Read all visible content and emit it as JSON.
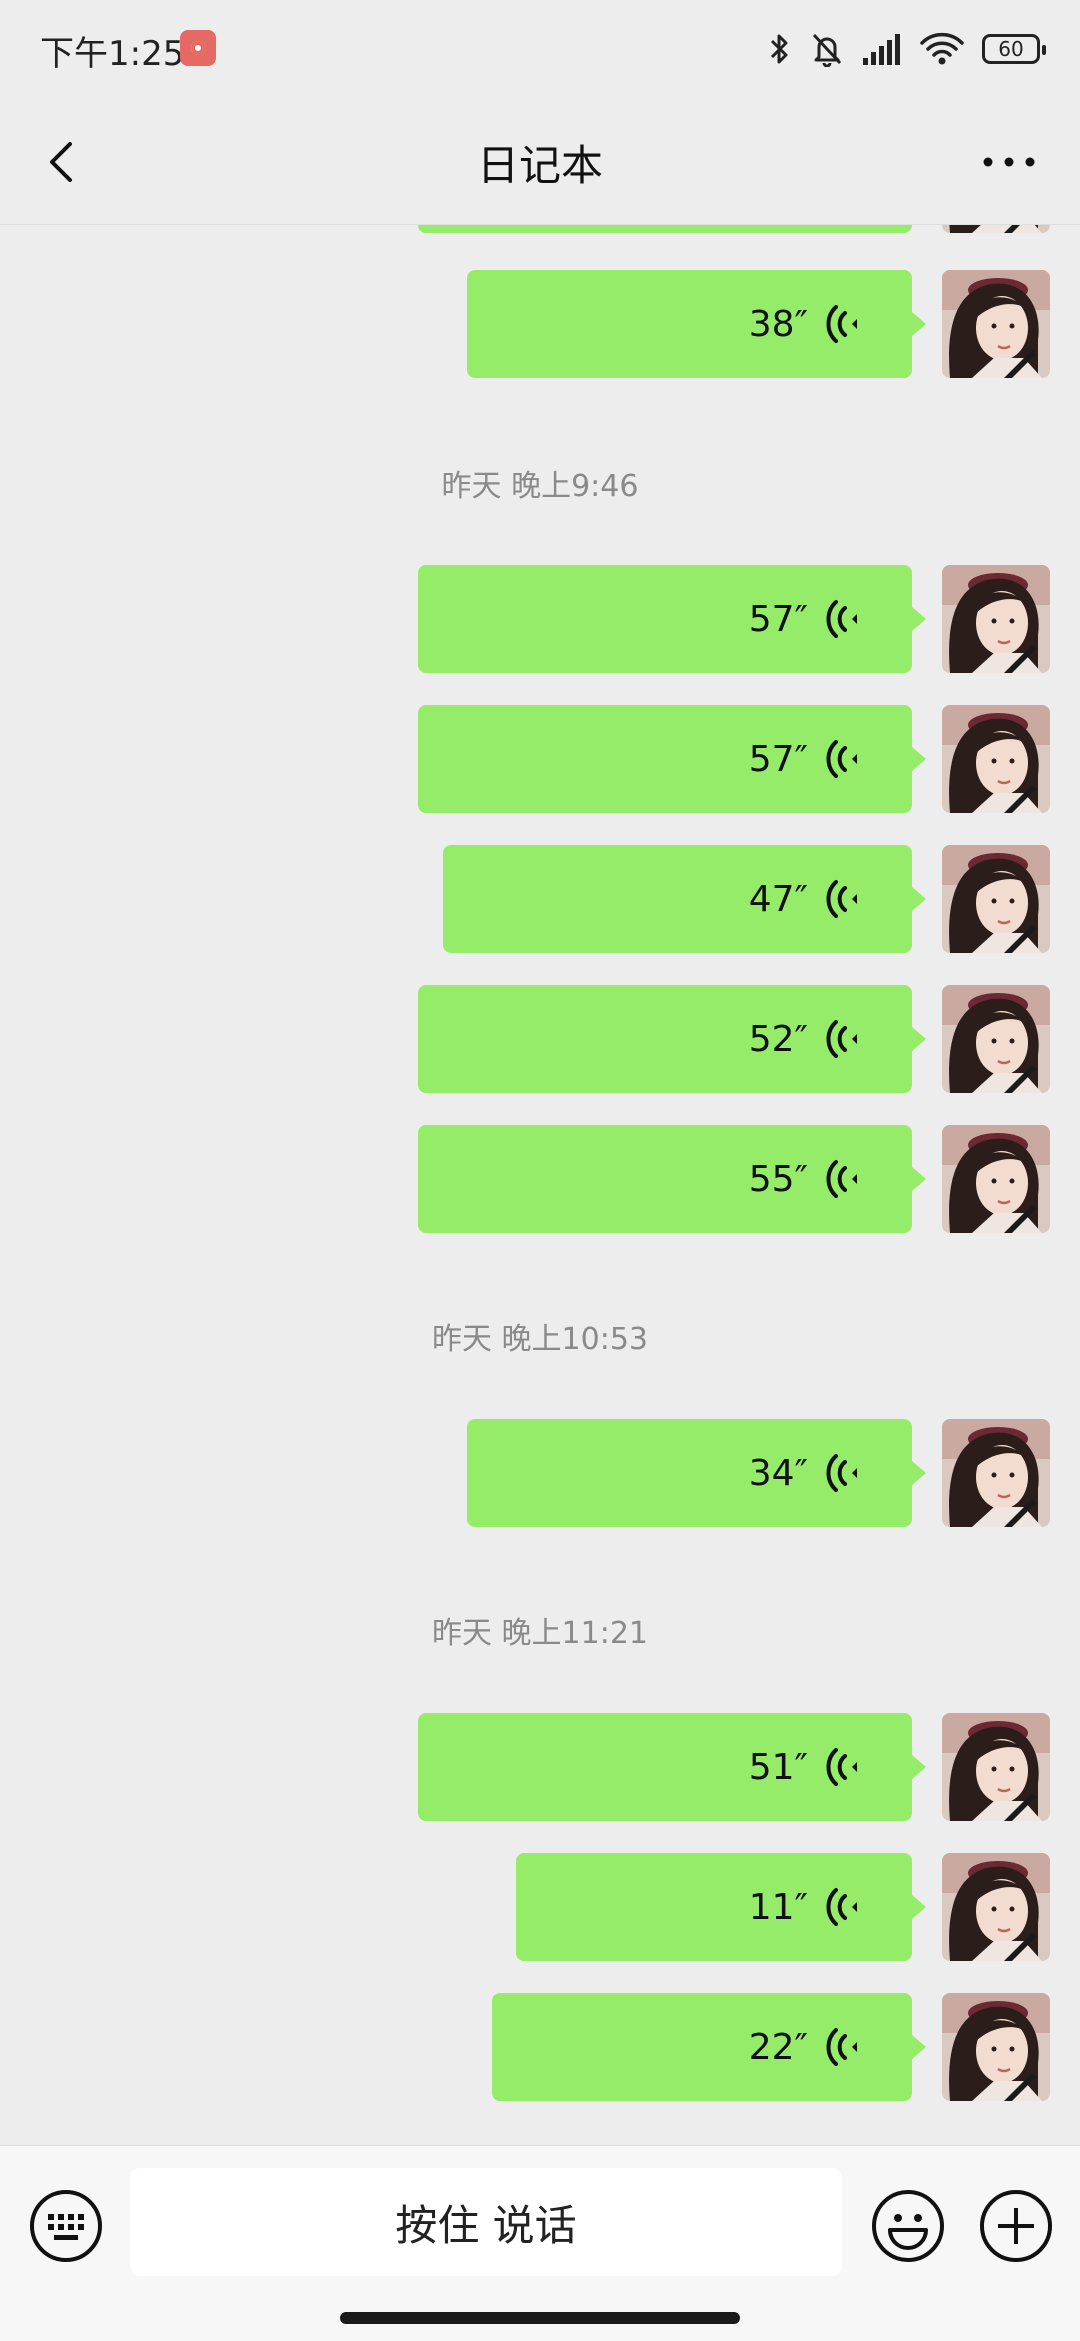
{
  "status_bar": {
    "time": "下午1:25",
    "battery": "60"
  },
  "nav": {
    "title": "日记本"
  },
  "messages": [
    {
      "duration": "38″"
    },
    {
      "duration": "57″"
    },
    {
      "duration": "57″"
    },
    {
      "duration": "47″"
    },
    {
      "duration": "52″"
    },
    {
      "duration": "55″"
    },
    {
      "duration": "34″"
    },
    {
      "duration": "51″"
    },
    {
      "duration": "11″"
    },
    {
      "duration": "22″"
    }
  ],
  "timestamps": [
    "昨天 晚上9:46",
    "昨天 晚上10:53",
    "昨天 晚上11:21"
  ],
  "input_bar": {
    "hold_to_talk_label": "按住 说话"
  },
  "colors": {
    "bubble": "#95ec69",
    "background": "#ededed"
  },
  "icons": [
    "back-arrow-icon",
    "more-dots-icon",
    "voice-wave-icon",
    "keyboard-icon",
    "emoji-icon",
    "plus-icon",
    "bluetooth-icon",
    "mute-bell-icon",
    "signal-icon",
    "wifi-icon",
    "battery-icon",
    "screen-record-icon"
  ]
}
